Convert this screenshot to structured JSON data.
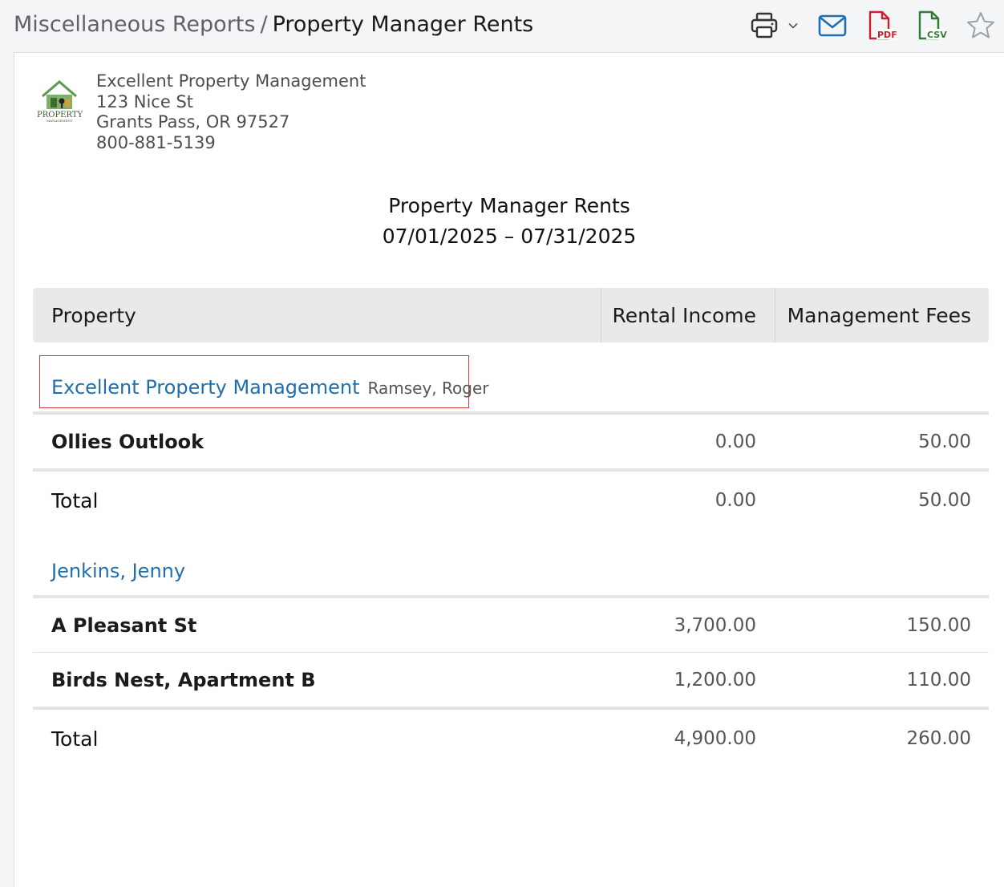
{
  "breadcrumb": {
    "parent": "Miscellaneous Reports",
    "separator": "/",
    "current": "Property Manager Rents"
  },
  "toolbar": {
    "icons": [
      "printer-icon",
      "chevron-down-icon",
      "email-icon",
      "pdf-icon",
      "csv-icon",
      "star-icon"
    ],
    "pdf_label": "PDF",
    "csv_label": "CSV",
    "colors": {
      "email": "#1f6fae",
      "pdf": "#c8202f",
      "csv": "#2e7d32",
      "print": "#333333",
      "star": "#9aa0a6"
    }
  },
  "company": {
    "name": "Excellent Property Management",
    "address1": "123 Nice St",
    "address2": "Grants Pass, OR 97527",
    "phone": "800-881-5139",
    "logo_text": "PROPERTY",
    "logo_subtext": "MANAGEMENT"
  },
  "report": {
    "title": "Property Manager Rents",
    "date_range": "07/01/2025 – 07/31/2025"
  },
  "table": {
    "headers": {
      "property": "Property",
      "rental_income": "Rental Income",
      "management_fees": "Management Fees"
    },
    "groups": [
      {
        "name": "Excellent Property Management",
        "subname": "Ramsey, Roger",
        "rows": [
          {
            "property": "Ollies Outlook",
            "rental_income": "0.00",
            "management_fees": "50.00"
          }
        ],
        "total": {
          "label": "Total",
          "rental_income": "0.00",
          "management_fees": "50.00"
        }
      },
      {
        "name": "Jenkins, Jenny",
        "subname": "",
        "rows": [
          {
            "property": "A Pleasant St",
            "rental_income": "3,700.00",
            "management_fees": "150.00"
          },
          {
            "property": "Birds Nest, Apartment B",
            "rental_income": "1,200.00",
            "management_fees": "110.00"
          }
        ],
        "total": {
          "label": "Total",
          "rental_income": "4,900.00",
          "management_fees": "260.00"
        }
      }
    ]
  }
}
